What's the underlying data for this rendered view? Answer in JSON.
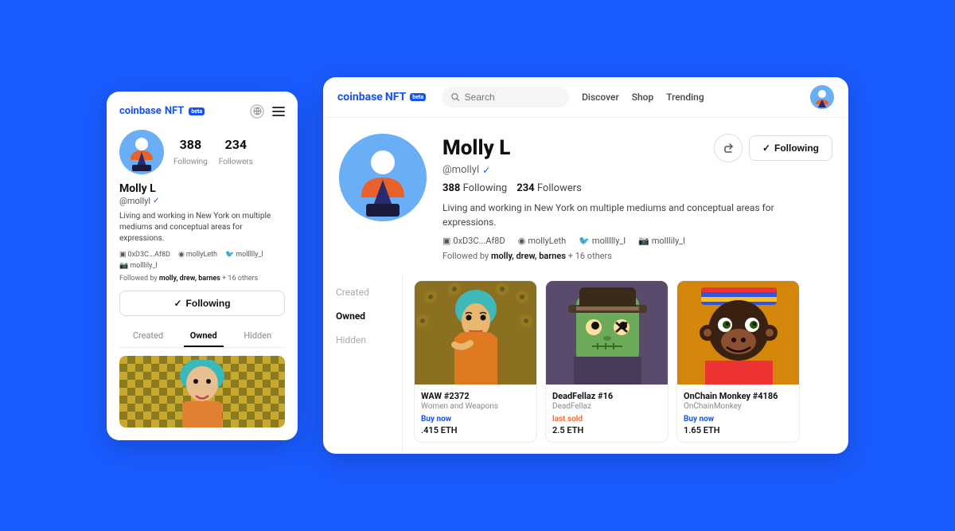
{
  "brand": {
    "name": "coinbase",
    "nft": "NFT",
    "beta": "beta"
  },
  "mobile": {
    "stats": {
      "following": "388",
      "following_label": "Following",
      "followers": "234",
      "followers_label": "Followers"
    },
    "user": {
      "name": "Molly L",
      "handle": "@mollyl",
      "bio": "Living and working in New York on multiple mediums and conceptual areas for expressions.",
      "wallet": "0xD3C...Af8D",
      "ens": "mollyLeth",
      "twitter": "mollllly_l",
      "instagram": "molllily_l"
    },
    "followed_by_text": "Followed by ",
    "followed_by_names": "molly, drew, barnes",
    "followed_by_others": "+ 16 others",
    "follow_button": "Following",
    "tabs": [
      "Created",
      "Owned",
      "Hidden"
    ]
  },
  "desktop": {
    "nav": {
      "search_placeholder": "Search",
      "discover": "Discover",
      "shop": "Shop",
      "trending": "Trending"
    },
    "user": {
      "name": "Molly L",
      "handle": "@mollyl",
      "following_count": "388",
      "following_label": "Following",
      "followers_count": "234",
      "followers_label": "Followers",
      "bio": "Living and working in New York on multiple mediums and conceptual areas for expressions.",
      "wallet": "0xD3C...Af8D",
      "ens": "mollyLeth",
      "twitter": "mollllly_l",
      "instagram": "molllily_l"
    },
    "followed_by_text": "Followed by ",
    "followed_by_names": "molly, drew, barnes",
    "followed_by_others": "+ 16 others",
    "follow_button": "Following",
    "tabs": [
      "Created",
      "Owned",
      "Hidden"
    ],
    "nfts": [
      {
        "title": "WAW #2372",
        "collection": "Women and Weapons",
        "action": "Buy now",
        "action_type": "buy",
        "price": ".415 ETH"
      },
      {
        "title": "DeadFellaz #16",
        "collection": "DeadFellaz",
        "action": "last sold",
        "action_type": "sold",
        "price": "2.5 ETH"
      },
      {
        "title": "OnChain Monkey #4186",
        "collection": "OnChainMonkey",
        "action": "Buy now",
        "action_type": "buy",
        "price": "1.65 ETH"
      }
    ]
  }
}
